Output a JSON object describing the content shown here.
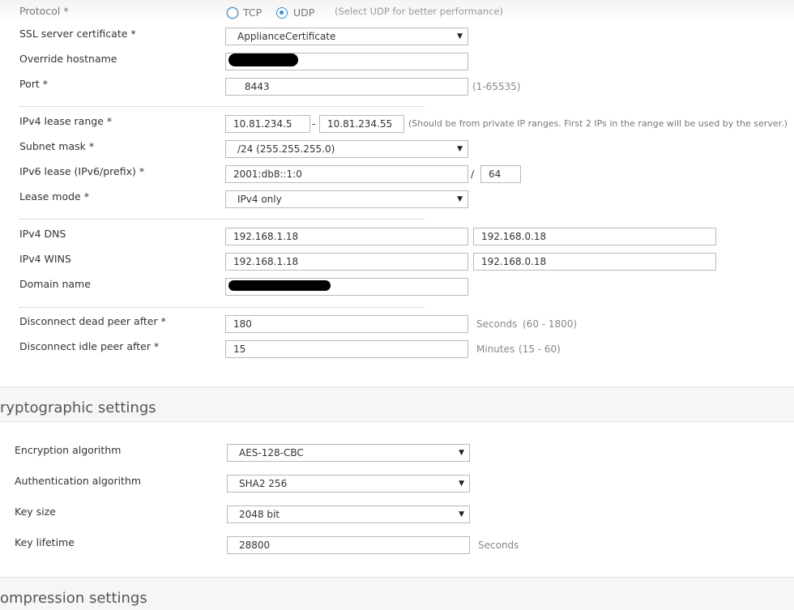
{
  "protocol": {
    "label": "Protocol *",
    "options": [
      "TCP",
      "UDP"
    ],
    "selected": "UDP",
    "hint": "(Select UDP for better performance)"
  },
  "ssl_cert": {
    "label": "SSL server certificate *",
    "value": "ApplianceCertificate"
  },
  "override_hostname": {
    "label": "Override hostname",
    "value": ""
  },
  "port": {
    "label": "Port *",
    "value": "8443",
    "hint": "(1-65535)"
  },
  "ipv4_lease": {
    "label": "IPv4 lease range *",
    "start": "10.81.234.5",
    "dash": "-",
    "end": "10.81.234.55",
    "hint": "(Should be from private IP ranges. First 2 IPs in the range will be used by the server.)"
  },
  "subnet_mask": {
    "label": "Subnet mask *",
    "value": "/24 (255.255.255.0)"
  },
  "ipv6_lease": {
    "label": "IPv6 lease (IPv6/prefix) *",
    "value": "2001:db8::1:0",
    "slash": "/",
    "prefix": "64"
  },
  "lease_mode": {
    "label": "Lease mode *",
    "value": "IPv4 only"
  },
  "ipv4_dns": {
    "label": "IPv4 DNS",
    "primary": "192.168.1.18",
    "secondary": "192.168.0.18"
  },
  "ipv4_wins": {
    "label": "IPv4 WINS",
    "primary": "192.168.1.18",
    "secondary": "192.168.0.18"
  },
  "domain_name": {
    "label": "Domain name",
    "value": ""
  },
  "dead_peer": {
    "label": "Disconnect dead peer after *",
    "value": "180",
    "unit": "Seconds",
    "range": "(60 - 1800)"
  },
  "idle_peer": {
    "label": "Disconnect idle peer after *",
    "value": "15",
    "unit": "Minutes",
    "range": "(15 - 60)"
  },
  "crypto_section": {
    "title": "ryptographic settings",
    "encryption": {
      "label": "Encryption algorithm",
      "value": "AES-128-CBC"
    },
    "authentication": {
      "label": "Authentication algorithm",
      "value": "SHA2 256"
    },
    "key_size": {
      "label": "Key size",
      "value": "2048 bit"
    },
    "key_lifetime": {
      "label": "Key lifetime",
      "value": "28800",
      "unit": "Seconds"
    }
  },
  "compression_section": {
    "title": "ompression settings"
  },
  "icons": {
    "caret": "▼"
  },
  "colors": {
    "accent": "#2f8fd8",
    "section_bg": "#f6f6f6",
    "border": "#b9b9b9"
  }
}
